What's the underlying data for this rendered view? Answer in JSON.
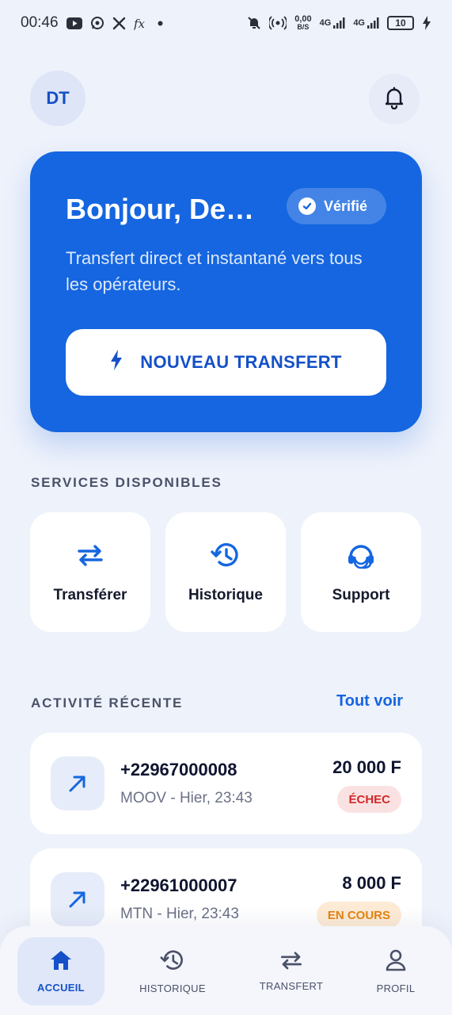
{
  "status_bar": {
    "time": "00:46",
    "data_rate_value": "0,00",
    "data_rate_unit": "B/S",
    "network_1": "4G",
    "network_2": "4G",
    "battery": "10"
  },
  "header": {
    "avatar_initials": "DT"
  },
  "hero": {
    "greeting": "Bonjour, Demetrius",
    "verified_label": "Vérifié",
    "subtitle": "Transfert direct et instantané vers tous les opérateurs.",
    "cta_label": "NOUVEAU TRANSFERT"
  },
  "services": {
    "title": "SERVICES DISPONIBLES",
    "items": [
      {
        "label": "Transférer",
        "icon": "transfer-arrows-icon"
      },
      {
        "label": "Historique",
        "icon": "history-icon"
      },
      {
        "label": "Support",
        "icon": "support-headset-icon"
      }
    ]
  },
  "activity": {
    "title": "ACTIVITÉ RÉCENTE",
    "see_all": "Tout voir",
    "items": [
      {
        "phone": "+22967000008",
        "meta": "MOOV - Hier, 23:43",
        "amount": "20 000 F",
        "status": "ÉCHEC"
      },
      {
        "phone": "+22961000007",
        "meta": "MTN - Hier, 23:43",
        "amount": "8 000 F",
        "status": "EN COURS"
      }
    ]
  },
  "nav": {
    "items": [
      {
        "label": "ACCUEIL",
        "icon": "home-icon",
        "active": true
      },
      {
        "label": "HISTORIQUE",
        "icon": "history-icon",
        "active": false
      },
      {
        "label": "TRANSFERT",
        "icon": "transfer-arrows-icon",
        "active": false
      },
      {
        "label": "PROFIL",
        "icon": "profile-icon",
        "active": false
      }
    ]
  },
  "colors": {
    "primary": "#1566e0",
    "background": "#eef2fb",
    "fail": "#d22a2a",
    "pending": "#e5840f"
  }
}
